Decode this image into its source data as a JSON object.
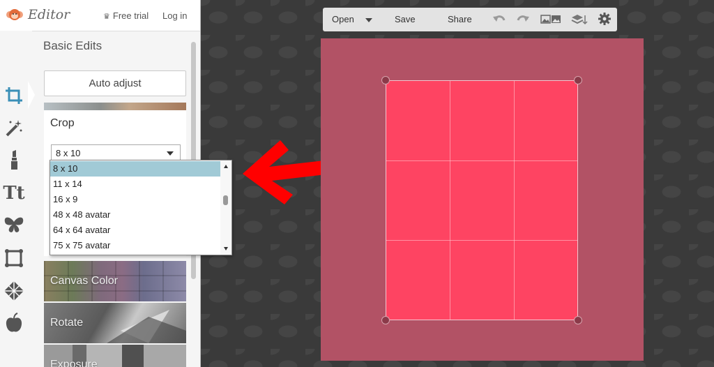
{
  "app": {
    "logo_text": "Editor",
    "free_trial": "Free trial",
    "login": "Log in"
  },
  "tools": [
    {
      "name": "crop-icon"
    },
    {
      "name": "effects-wand-icon"
    },
    {
      "name": "touch-up-lipstick-icon"
    },
    {
      "name": "text-icon",
      "label": "Tt"
    },
    {
      "name": "overlays-butterfly-icon"
    },
    {
      "name": "frames-icon"
    },
    {
      "name": "textures-icon"
    },
    {
      "name": "seasonal-apple-icon"
    }
  ],
  "panel": {
    "section_title": "Basic Edits",
    "auto_adjust": "Auto adjust",
    "crop": {
      "title": "Crop",
      "selected": "8 x 10",
      "options": [
        "8 x 10",
        "11 x 14",
        "16 x 9",
        "48 x 48 avatar",
        "64 x 64 avatar",
        "75 x 75 avatar"
      ]
    },
    "cards": [
      "Canvas Color",
      "Rotate",
      "Exposure"
    ]
  },
  "toolbar": {
    "open": "Open",
    "save": "Save",
    "share": "Share",
    "icons": [
      "undo-icon",
      "redo-icon",
      "image-icon",
      "layers-icon",
      "settings-icon"
    ]
  },
  "colors": {
    "canvas": "#b25265",
    "crop_area": "#fe4462",
    "selected_option": "#a1cad6",
    "arrow": "#ff0000"
  }
}
